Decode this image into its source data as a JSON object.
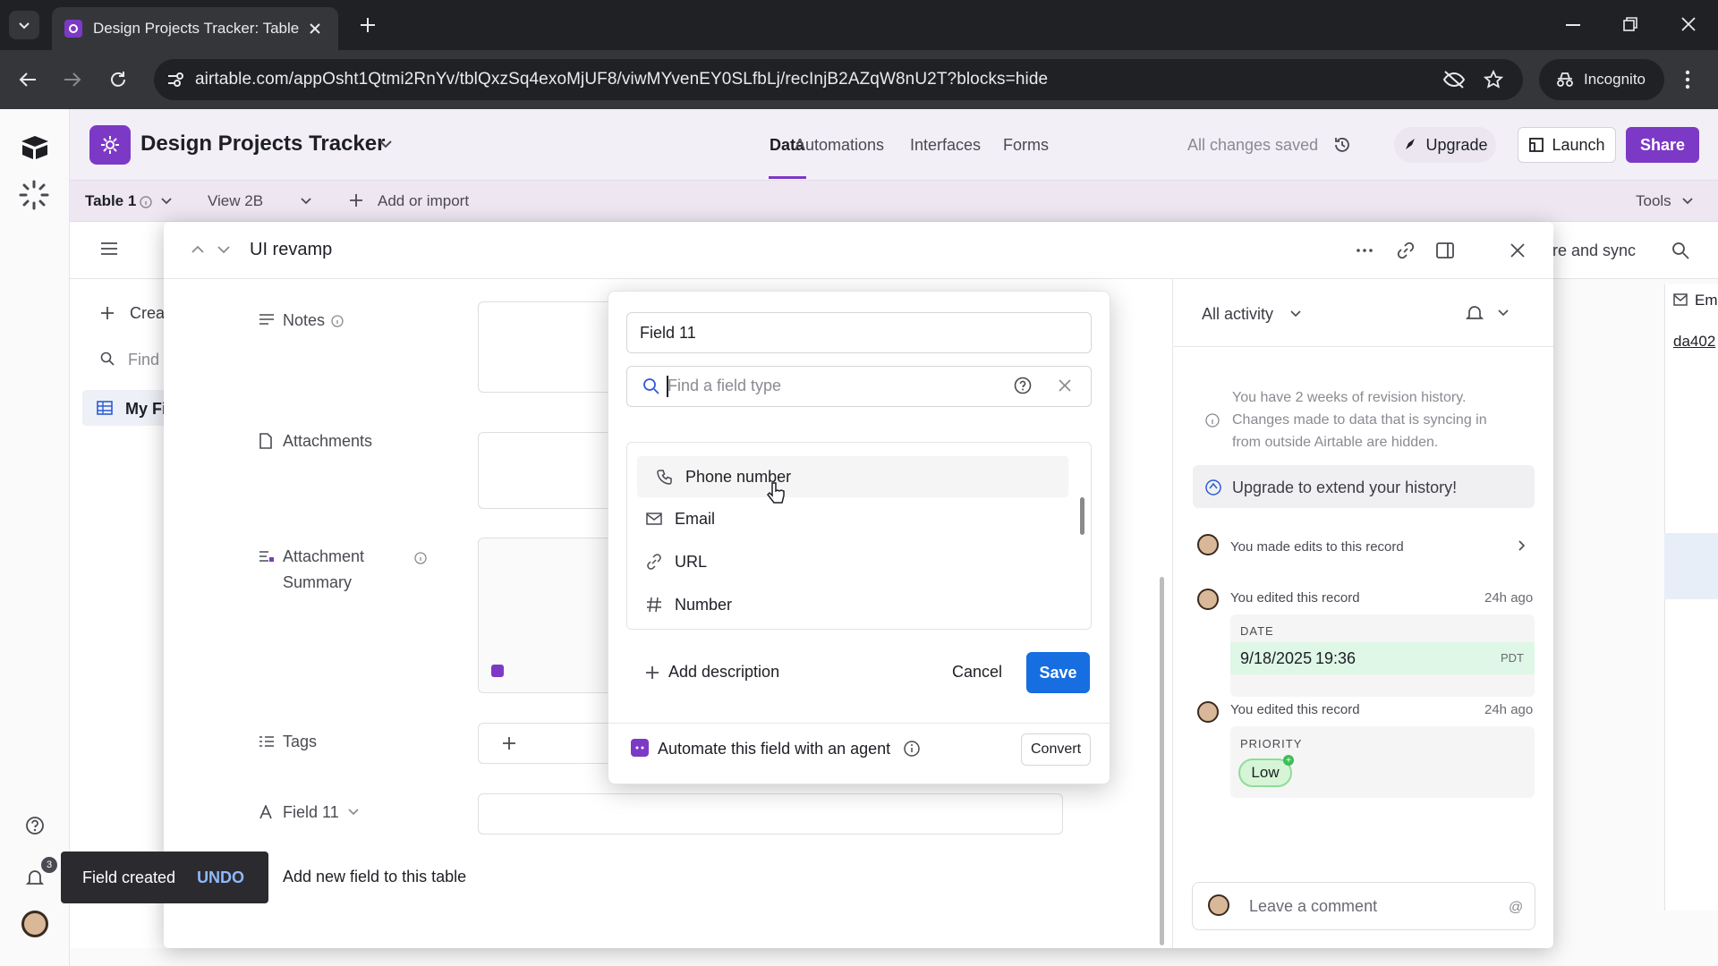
{
  "browser": {
    "tab_title": "Design Projects Tracker: Table 1",
    "url": "airtable.com/appOsht1Qtmi2RnYv/tblQxzSq4exoMjUF8/viwMYvenEY0SLfbLj/recInjB2AZqW8nU2T?blocks=hide",
    "incognito_label": "Incognito"
  },
  "header": {
    "base_name": "Design Projects Tracker",
    "tabs": [
      "Data",
      "Automations",
      "Interfaces",
      "Forms"
    ],
    "saved_status": "All changes saved",
    "upgrade": "Upgrade",
    "launch": "Launch",
    "share": "Share"
  },
  "tablebar": {
    "table_name": "Table 1",
    "view_name": "View 2B",
    "add_import": "Add or import",
    "tools": "Tools"
  },
  "background": {
    "sidebar_create": "Crea",
    "sidebar_find": "Find",
    "sidebar_item": "My Fi",
    "share_sync": "re and sync",
    "col_header": "Em",
    "cell_value": "da402"
  },
  "record": {
    "title": "UI revamp",
    "fields": {
      "notes": "Notes",
      "attachments": "Attachments",
      "attachment_summary_1": "Attachment",
      "attachment_summary_2": "Summary",
      "tags": "Tags",
      "field11": "Field 11"
    },
    "add_new_field": "Add new field to this table"
  },
  "activity": {
    "filter": "All activity",
    "revision_notice": [
      "You have 2 weeks of revision history.",
      "Changes made to data that is syncing in",
      "from outside Airtable are hidden."
    ],
    "upgrade_history": "Upgrade to extend your history!",
    "entry1": "You made edits to this record",
    "entry2": "You edited this record",
    "entry2_time": "24h ago",
    "date_label": "DATE",
    "date_value": "9/18/2025",
    "time_value": "19:36",
    "tz": "PDT",
    "entry3": "You edited this record",
    "entry3_time": "24h ago",
    "priority_label": "PRIORITY",
    "priority_value": "Low",
    "comment_placeholder": "Leave a comment"
  },
  "popup": {
    "field_name": "Field 11",
    "search_placeholder": "Find a field type",
    "options": [
      {
        "label": "Phone number",
        "icon": "phone-icon"
      },
      {
        "label": "Email",
        "icon": "mail-icon"
      },
      {
        "label": "URL",
        "icon": "link-icon"
      },
      {
        "label": "Number",
        "icon": "hash-icon"
      }
    ],
    "add_description": "Add description",
    "cancel": "Cancel",
    "save": "Save",
    "agent_label": "Automate this field with an agent",
    "convert": "Convert"
  },
  "toast": {
    "message": "Field created",
    "undo": "UNDO"
  },
  "notifications_count": "3",
  "colors": {
    "accent": "#7c39c6",
    "primary_button": "#166ee1",
    "date_change_bg": "#dff7e6",
    "priority_pill": "#d6f5d6"
  }
}
